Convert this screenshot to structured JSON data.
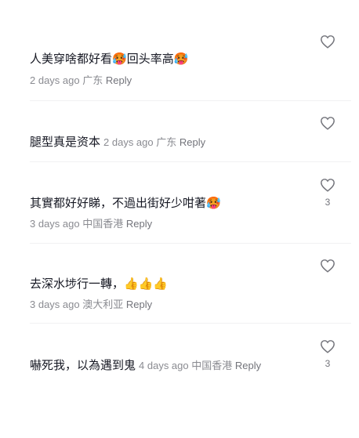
{
  "comments": [
    {
      "text": "人美穿啥都好看",
      "emoji_a": "🥵",
      "text2": "回头率高",
      "emoji_b": "🥵",
      "time": "2 days ago",
      "location": "广东",
      "reply": "Reply",
      "likes": ""
    },
    {
      "text": "腿型真是资本",
      "time": "2 days ago",
      "location": "广东",
      "reply": "Reply",
      "likes": ""
    },
    {
      "text": "其實都好好睇，不過出街好少咁著",
      "emoji_a": "🥵",
      "time": "3 days ago",
      "location": "中国香港",
      "reply": "Reply",
      "likes": "3"
    },
    {
      "text": "去深水埗行一轉，",
      "emoji_a": "👍👍👍",
      "time": "3 days ago",
      "location": "澳大利亚",
      "reply": "Reply",
      "likes": ""
    },
    {
      "text": "嚇死我，以為遇到鬼",
      "time": "4 days ago",
      "location": "中国香港",
      "reply": "Reply",
      "likes": "3"
    }
  ],
  "icons": {
    "like": "heart-outline-icon"
  },
  "colors": {
    "text": "#161823",
    "meta": "#8a8b91",
    "divider": "#f1f1f2"
  }
}
